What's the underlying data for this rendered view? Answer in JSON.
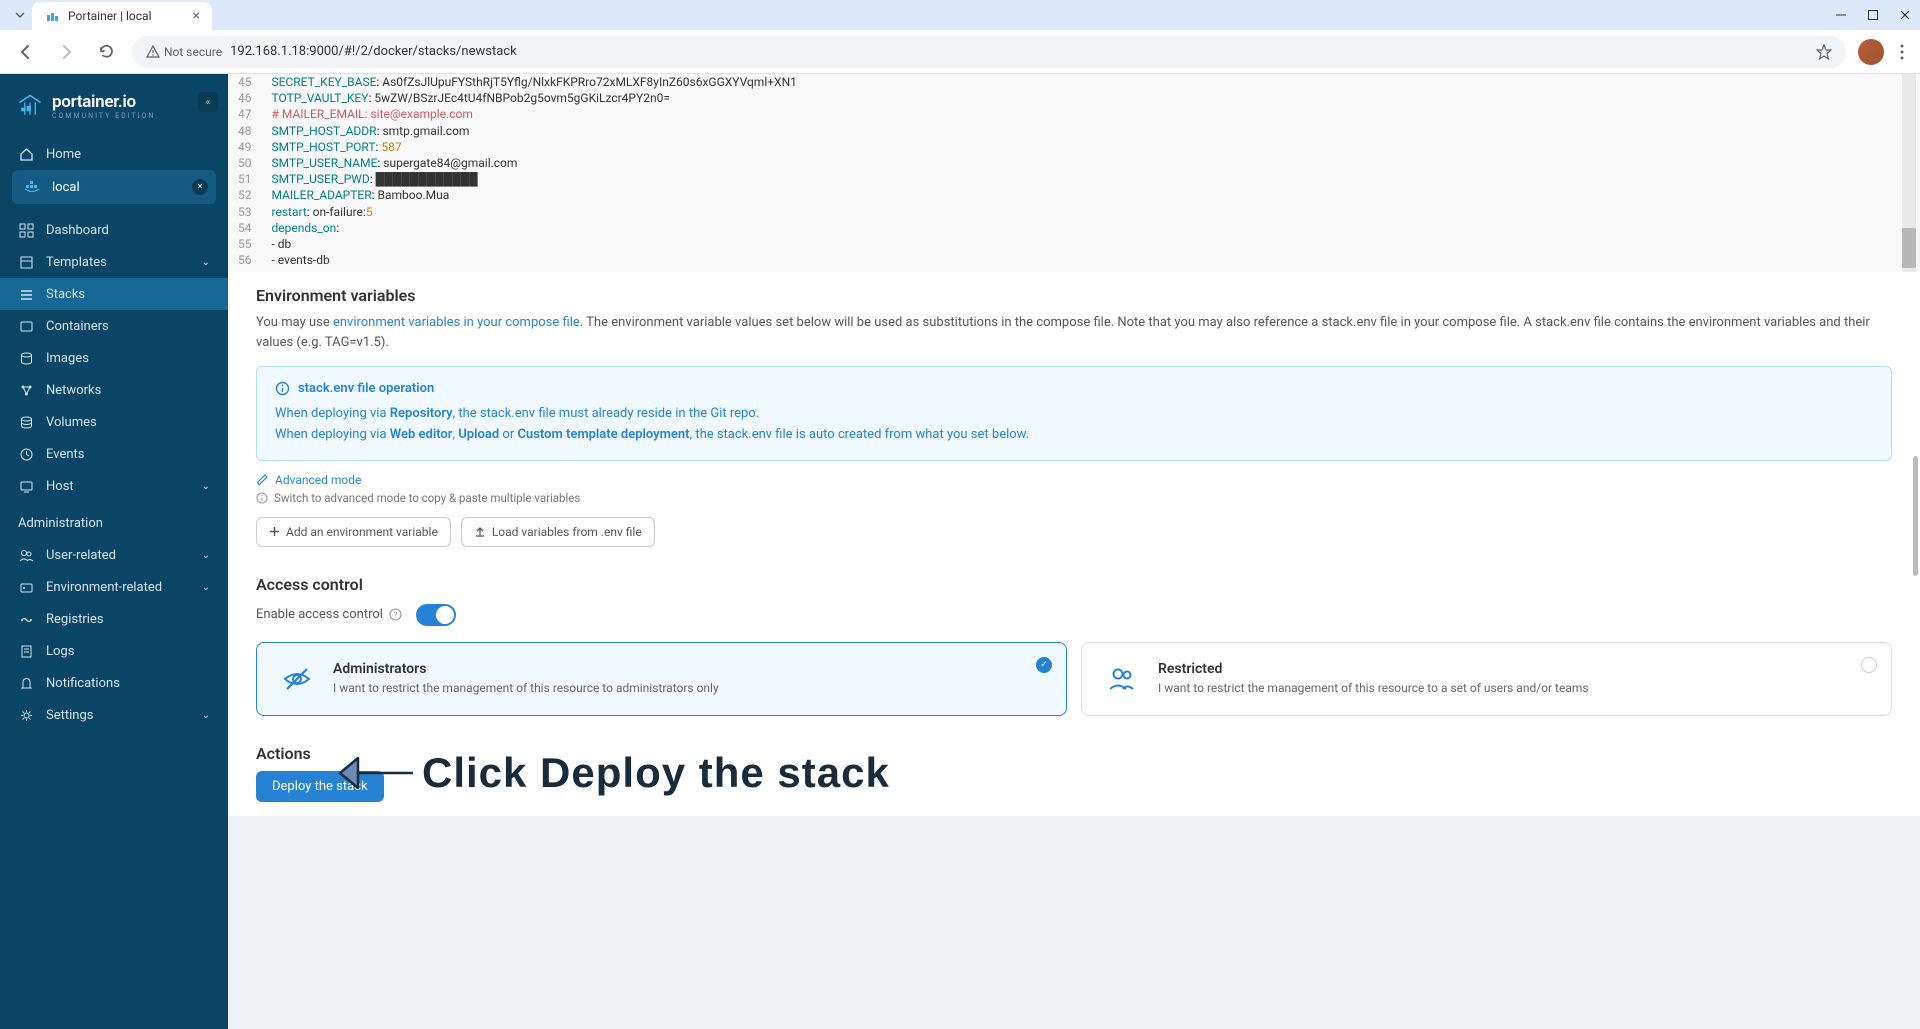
{
  "browser": {
    "tab_title": "Portainer | local",
    "security_label": "Not secure",
    "url": "192.168.1.18:9000/#!/2/docker/stacks/newstack"
  },
  "logo": {
    "main": "portainer.io",
    "sub": "COMMUNITY EDITION"
  },
  "env": {
    "label": "local"
  },
  "nav": {
    "home": "Home",
    "items": [
      {
        "label": "Dashboard"
      },
      {
        "label": "Templates",
        "chevron": true
      },
      {
        "label": "Stacks",
        "active": true
      },
      {
        "label": "Containers"
      },
      {
        "label": "Images"
      },
      {
        "label": "Networks"
      },
      {
        "label": "Volumes"
      },
      {
        "label": "Events"
      },
      {
        "label": "Host",
        "chevron": true
      }
    ],
    "admin_title": "Administration",
    "admin_items": [
      {
        "label": "User-related",
        "chevron": true
      },
      {
        "label": "Environment-related",
        "chevron": true
      },
      {
        "label": "Registries"
      },
      {
        "label": "Logs"
      },
      {
        "label": "Notifications"
      },
      {
        "label": "Settings",
        "chevron": true
      }
    ]
  },
  "code": {
    "lines": [
      {
        "n": 45,
        "indent": 3,
        "key": "SECRET_KEY_BASE",
        "val": "As0fZsJlUpuFYSthRjT5Yflg/NlxkFKPRro72xMLXF8yInZ60s6xGGXYVqml+XN1"
      },
      {
        "n": 46,
        "indent": 3,
        "key": "TOTP_VAULT_KEY",
        "val": "5wZW/BSzrJEc4tU4fNBPob2g5ovm5gGKiLzcr4PY2n0="
      },
      {
        "n": 47,
        "indent": 2,
        "comment": "# MAILER_EMAIL: site@example.com"
      },
      {
        "n": 48,
        "indent": 3,
        "key": "SMTP_HOST_ADDR",
        "val": "smtp.gmail.com"
      },
      {
        "n": 49,
        "indent": 3,
        "key": "SMTP_HOST_PORT",
        "val": "587",
        "isnum": true
      },
      {
        "n": 50,
        "indent": 3,
        "key": "SMTP_USER_NAME",
        "val": "supergate84@gmail.com"
      },
      {
        "n": 51,
        "indent": 3,
        "key": "SMTP_USER_PWD",
        "val": "████████████"
      },
      {
        "n": 52,
        "indent": 3,
        "key": "MAILER_ADAPTER",
        "val": "Bamboo.Mua"
      },
      {
        "n": 53,
        "indent": 2,
        "key": "restart",
        "val": "on-failure:5",
        "valparts": [
          "on-failure:",
          "5"
        ]
      },
      {
        "n": 54,
        "indent": 2,
        "key": "depends_on",
        "val": ""
      },
      {
        "n": 55,
        "indent": 3,
        "raw": "- db"
      },
      {
        "n": 56,
        "indent": 3,
        "raw": "- events-db"
      }
    ]
  },
  "env_section": {
    "title": "Environment variables",
    "help_pre": "You may use ",
    "help_link": "environment variables in your compose file",
    "help_post": ". The environment variable values set below will be used as substitutions in the compose file. Note that you may also reference a stack.env file in your compose file. A stack.env file contains the environment variables and their values (e.g. TAG=v1.5).",
    "alert_title": "stack.env file operation",
    "alert_l1_pre": "When deploying via ",
    "alert_l1_b": "Repository",
    "alert_l1_post": ", the stack.env file must already reside in the Git repo.",
    "alert_l2_pre": "When deploying via ",
    "alert_l2_b1": "Web editor",
    "alert_l2_sep1": ", ",
    "alert_l2_b2": "Upload",
    "alert_l2_sep2": " or ",
    "alert_l2_b3": "Custom template deployment",
    "alert_l2_post": ", the stack.env file is auto created from what you set below.",
    "adv_mode": "Advanced mode",
    "hint": "Switch to advanced mode to copy & paste multiple variables",
    "btn_add": "Add an environment variable",
    "btn_load": "Load variables from .env file"
  },
  "access": {
    "title": "Access control",
    "enable_label": "Enable access control",
    "admins_title": "Administrators",
    "admins_desc": "I want to restrict the management of this resource to administrators only",
    "restricted_title": "Restricted",
    "restricted_desc": "I want to restrict the management of this resource to a set of users and/or teams"
  },
  "actions": {
    "title": "Actions",
    "deploy": "Deploy the stack"
  },
  "annotation": "Click Deploy the stack"
}
